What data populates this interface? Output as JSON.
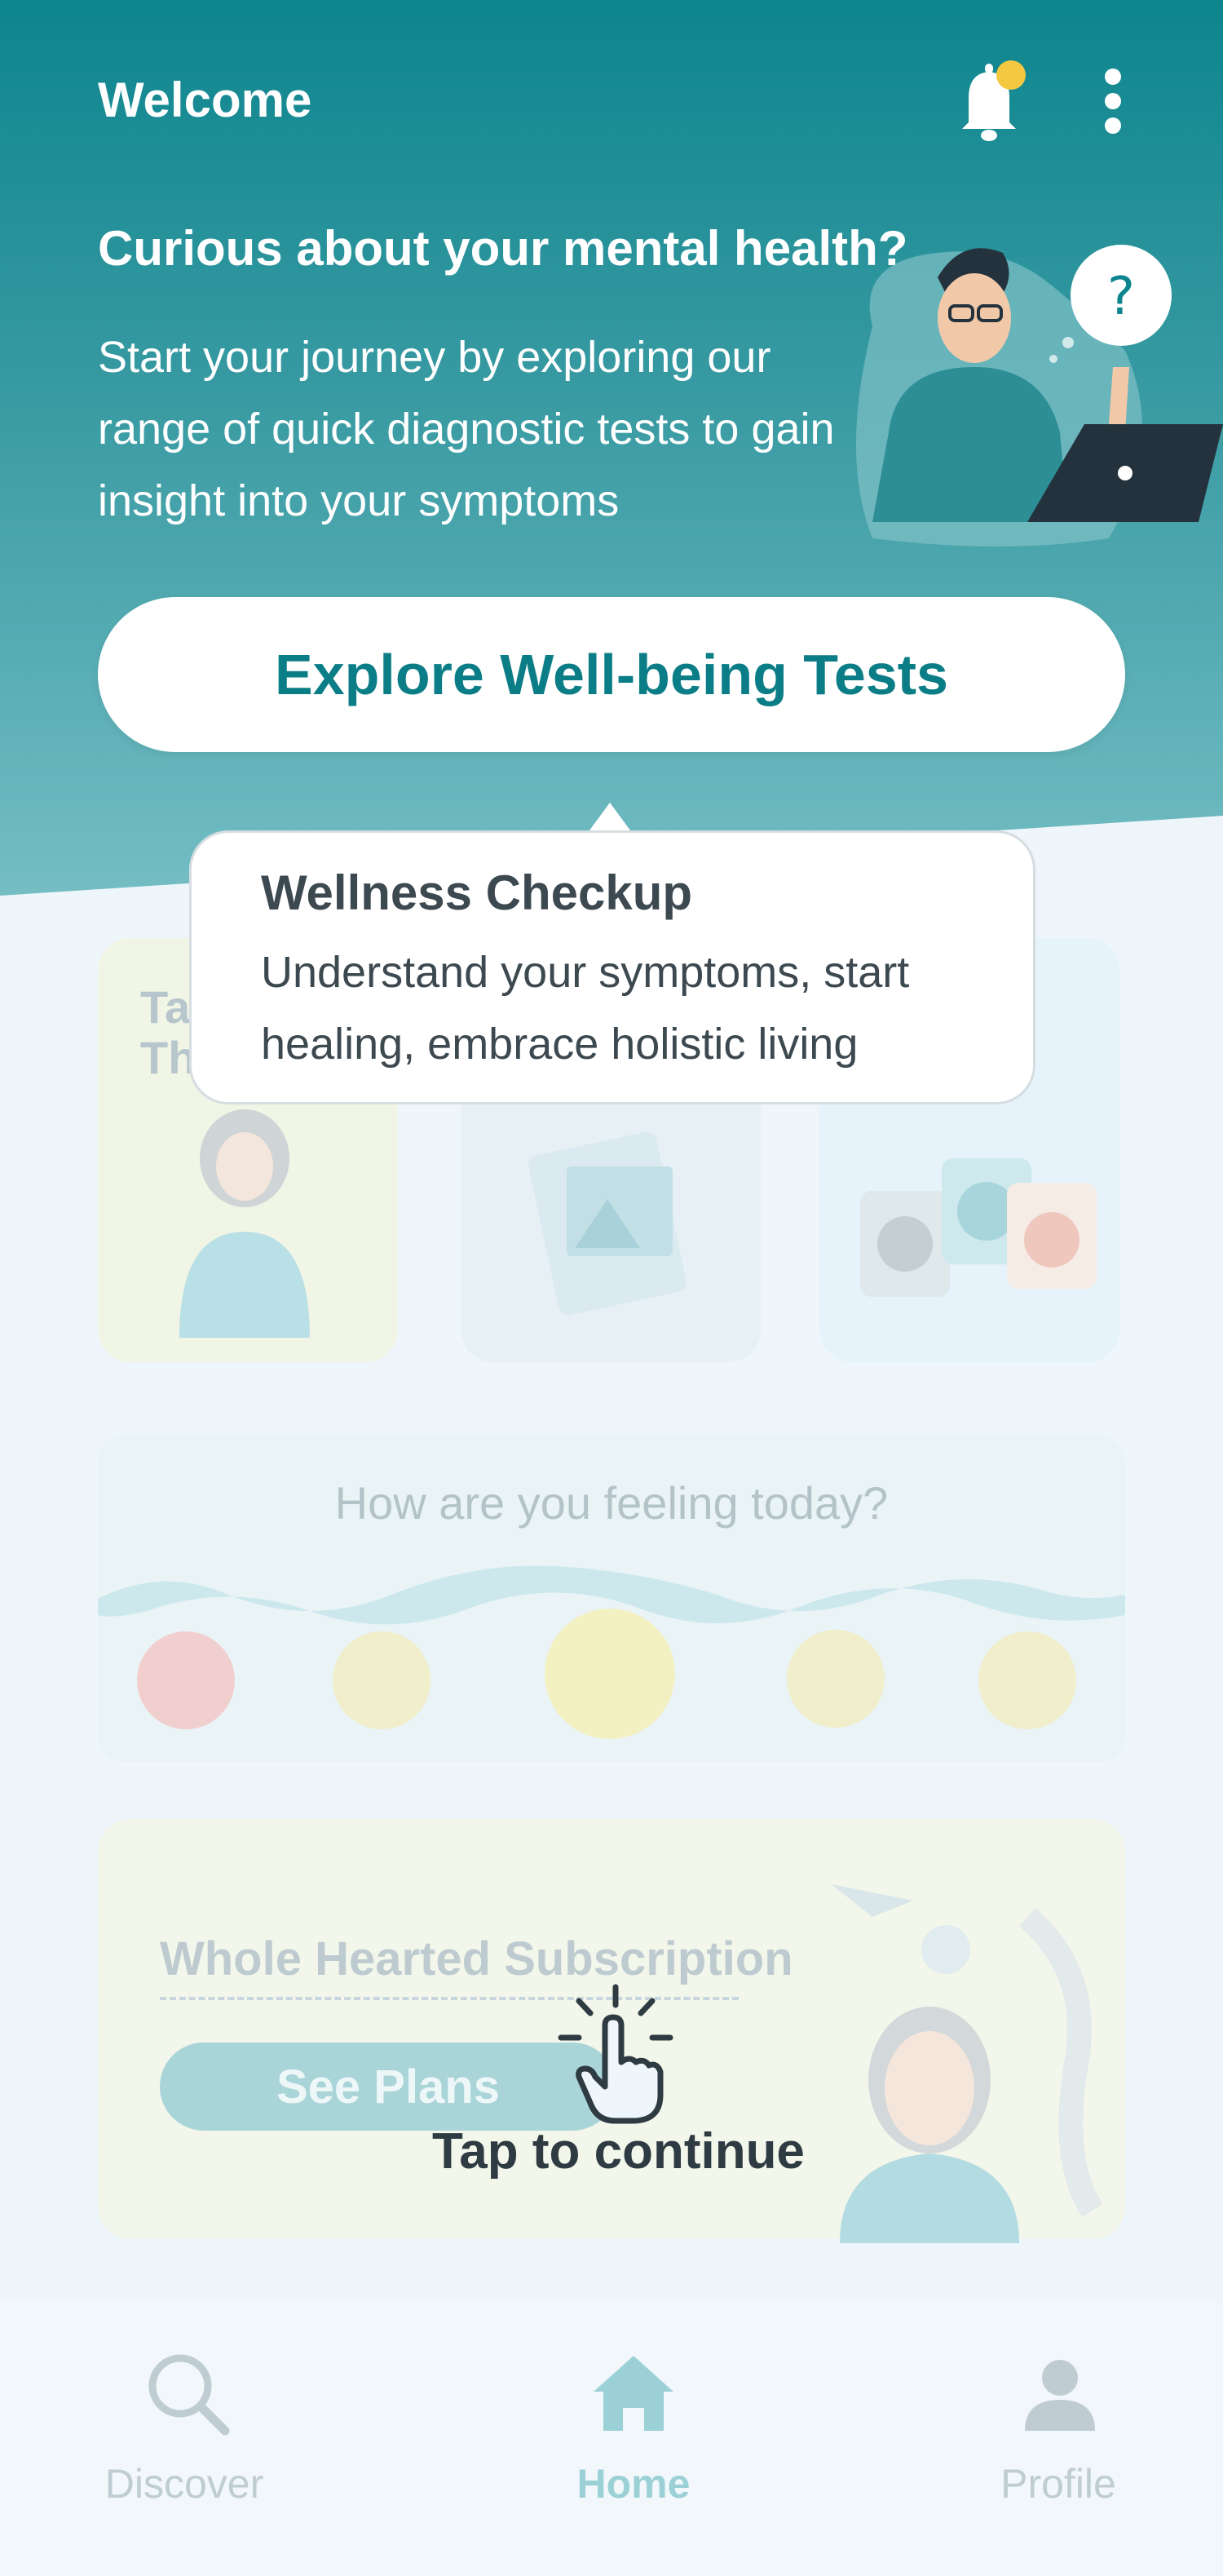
{
  "header": {
    "welcome": "Welcome",
    "heading": "Curious about your mental health?",
    "description": "Start your journey by exploring our range of quick diagnostic tests to gain insight into your symptoms",
    "explore_button": "Explore Well-being Tests"
  },
  "tooltip": {
    "title": "Wellness Checkup",
    "body": "Understand your symptoms, start healing, embrace holistic living"
  },
  "cards": {
    "card1_text": "Ta\nThe"
  },
  "mood": {
    "title": "How are you feeling today?"
  },
  "subscription": {
    "title": "Whole Hearted Subscription",
    "button": "See Plans"
  },
  "tap_hint": "Tap to continue",
  "nav": {
    "discover": "Discover",
    "home": "Home",
    "profile": "Profile"
  },
  "colors": {
    "header_teal": "#0d858e",
    "accent": "#0b7d86",
    "notification_dot": "#f5c842"
  }
}
